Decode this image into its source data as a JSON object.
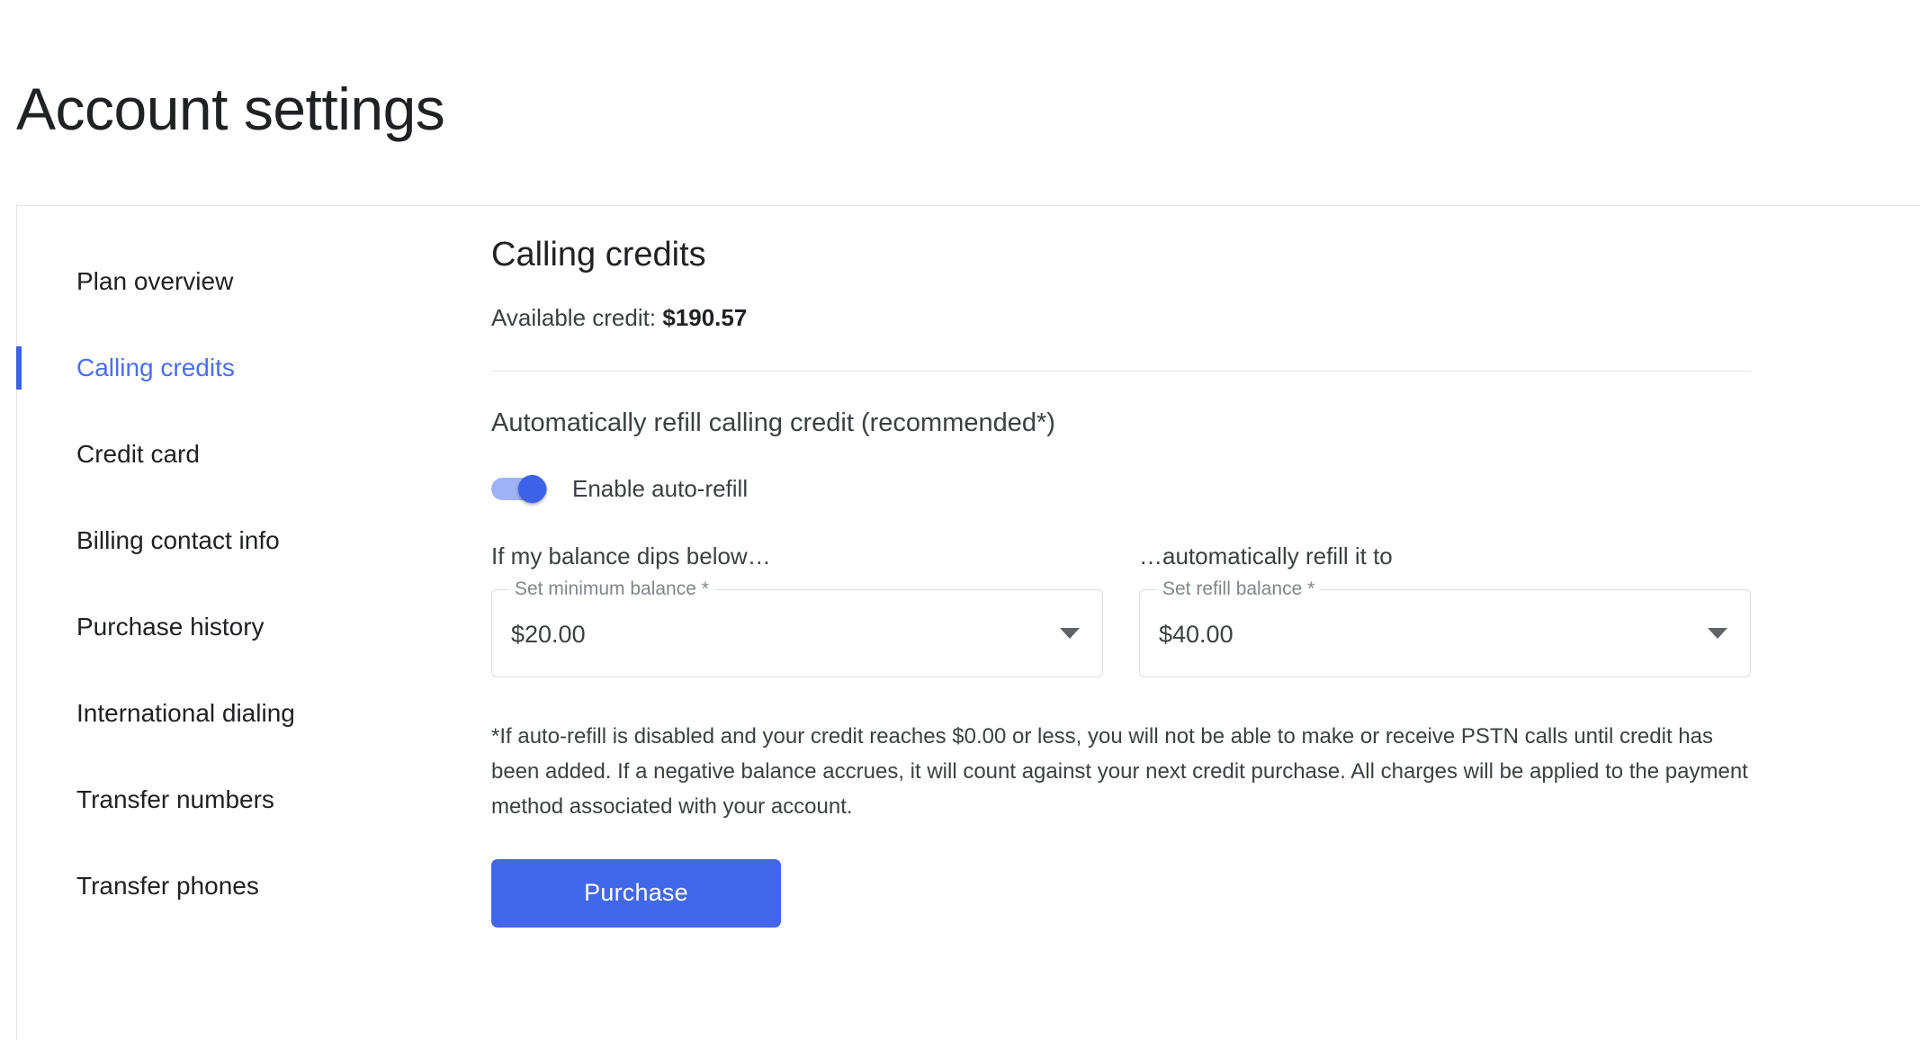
{
  "page": {
    "title": "Account settings"
  },
  "sidebar": {
    "items": [
      {
        "label": "Plan overview",
        "active": false
      },
      {
        "label": "Calling credits",
        "active": true
      },
      {
        "label": "Credit card",
        "active": false
      },
      {
        "label": "Billing contact info",
        "active": false
      },
      {
        "label": "Purchase history",
        "active": false
      },
      {
        "label": "International dialing",
        "active": false
      },
      {
        "label": "Transfer numbers",
        "active": false
      },
      {
        "label": "Transfer phones",
        "active": false
      }
    ]
  },
  "main": {
    "section_title": "Calling credits",
    "available_credit_label": "Available credit:",
    "available_credit_amount": "$190.57",
    "refill_heading": "Automatically refill calling credit (recommended*)",
    "toggle": {
      "label": "Enable auto-refill",
      "enabled": true
    },
    "min_balance": {
      "caption": "If my balance dips below…",
      "float_label": "Set minimum balance *",
      "value": "$20.00"
    },
    "refill_balance": {
      "caption": "…automatically refill it to",
      "float_label": "Set refill balance *",
      "value": "$40.00"
    },
    "disclaimer": "*If auto-refill is disabled and your credit reaches $0.00 or less, you will not be able to make or receive PSTN calls until credit has been added. If a negative balance accrues, it will count against your next credit purchase. All charges will be applied to the payment method associated with your account.",
    "purchase_button": "Purchase"
  },
  "colors": {
    "accent_blue": "#4267e8",
    "active_nav_text": "#4a6ef0",
    "active_nav_indicator": "#3b62e8",
    "toggle_track": "#9eb3f6",
    "toggle_thumb": "#3b62e8",
    "border": "#e4e6e9",
    "field_outline": "#dadce0",
    "label_gray": "#80868b",
    "body_text": "#3c4043"
  }
}
